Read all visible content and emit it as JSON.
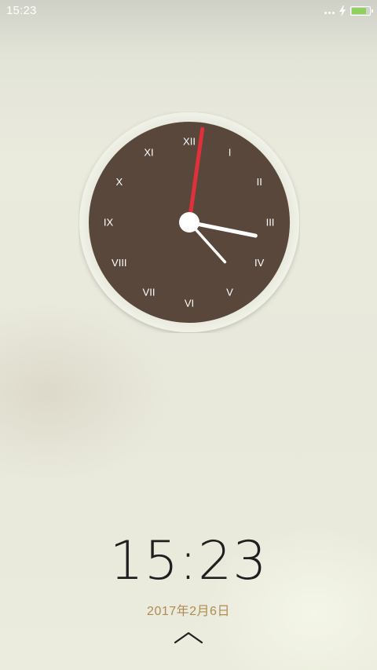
{
  "status_bar": {
    "time": "15:23",
    "icons": [
      "more-dots-icon",
      "charging-bolt-icon",
      "battery-icon"
    ],
    "battery_level": 0.85,
    "battery_color": "#8fd060"
  },
  "clock": {
    "numerals": [
      "XII",
      "I",
      "II",
      "III",
      "IV",
      "V",
      "VI",
      "VII",
      "VIII",
      "IX",
      "X",
      "XI"
    ],
    "hour": 15,
    "minute": 23,
    "second": 1,
    "face_color": "#5a473b",
    "rim_color": "#e9eade",
    "second_hand_color": "#e0303c",
    "hand_color": "#ffffff"
  },
  "lockscreen": {
    "time": "15:23",
    "date": "2017年2月6日",
    "unlock_icon": "chevron-up-icon"
  }
}
